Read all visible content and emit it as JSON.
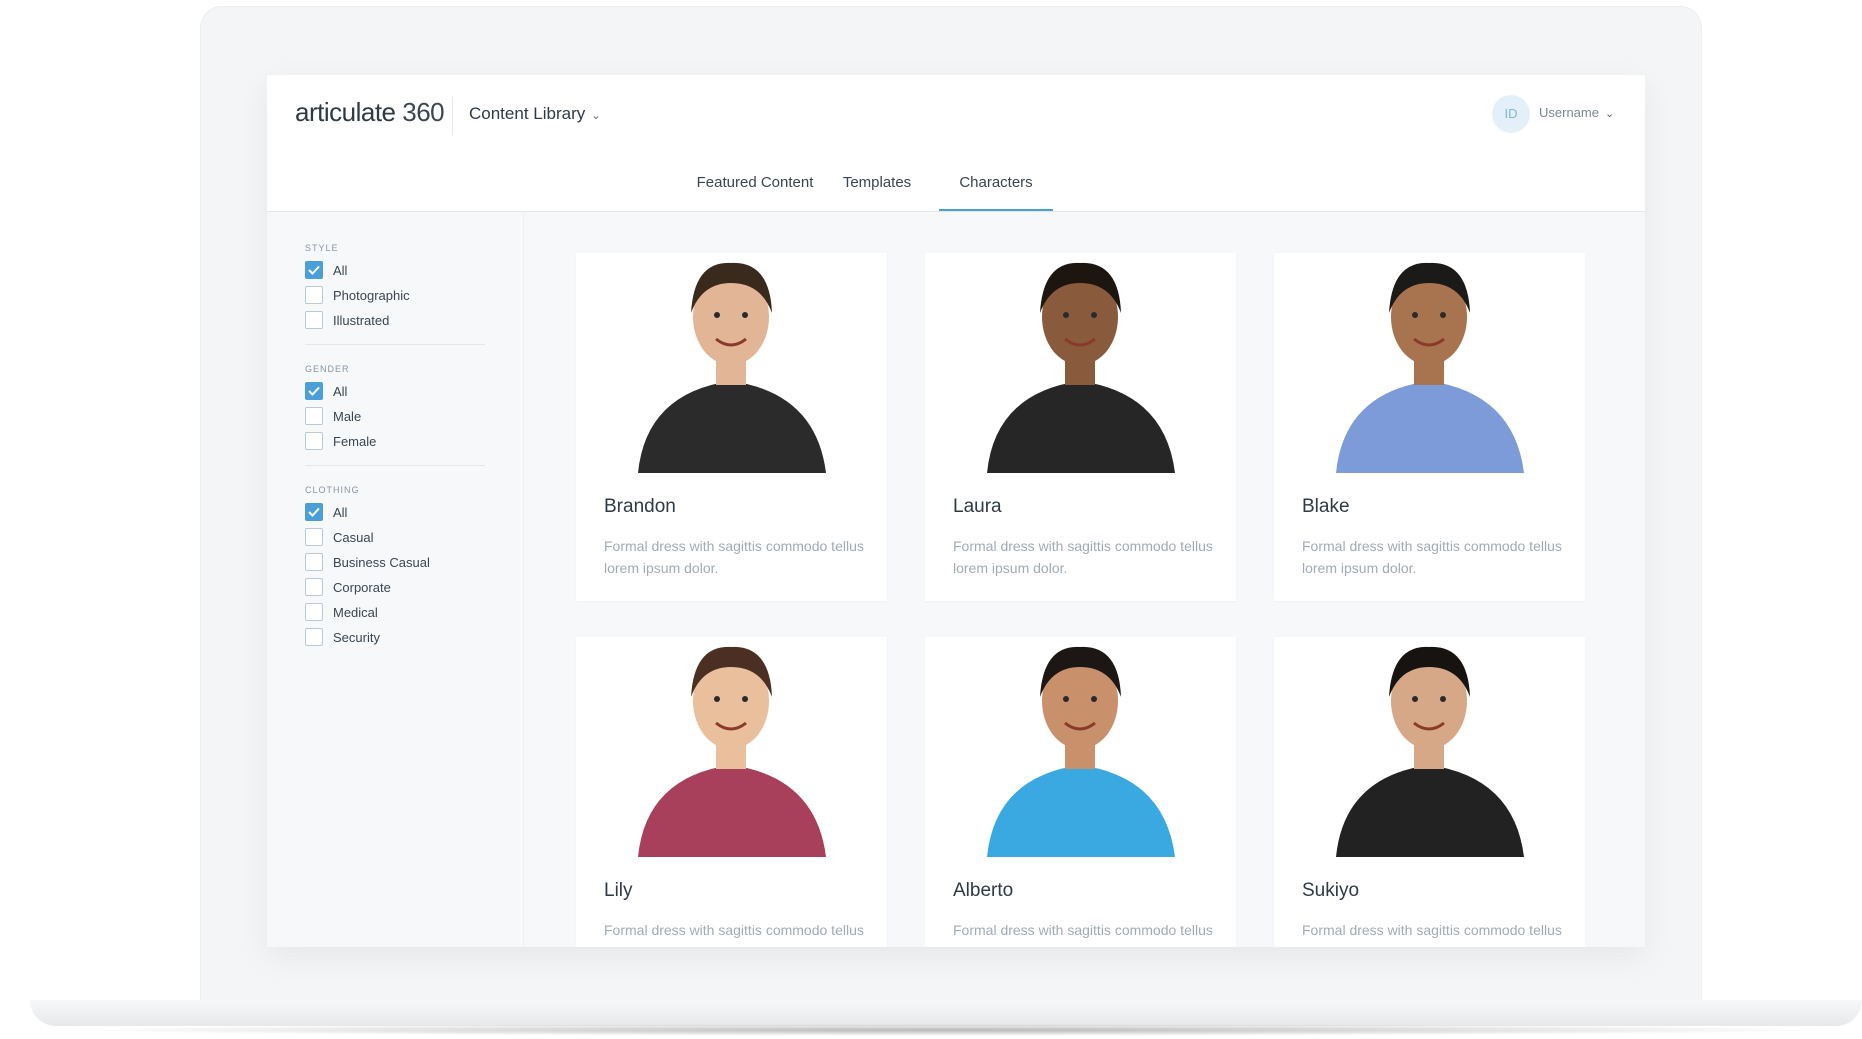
{
  "app": {
    "logo_text": "articulate",
    "logo_number": "360",
    "section": "Content Library",
    "avatar_initials": "ID",
    "username": "Username"
  },
  "tabs": [
    {
      "label": "Featured Content",
      "active": false
    },
    {
      "label": "Templates",
      "active": false
    },
    {
      "label": "Characters",
      "active": true
    }
  ],
  "filters": [
    {
      "title": "STYLE",
      "options": [
        {
          "label": "All",
          "checked": true
        },
        {
          "label": "Photographic",
          "checked": false
        },
        {
          "label": "Illustrated",
          "checked": false
        }
      ]
    },
    {
      "title": "GENDER",
      "options": [
        {
          "label": "All",
          "checked": true
        },
        {
          "label": "Male",
          "checked": false
        },
        {
          "label": "Female",
          "checked": false
        }
      ]
    },
    {
      "title": "CLOTHING",
      "options": [
        {
          "label": "All",
          "checked": true
        },
        {
          "label": "Casual",
          "checked": false
        },
        {
          "label": "Business Casual",
          "checked": false
        },
        {
          "label": "Corporate",
          "checked": false
        },
        {
          "label": "Medical",
          "checked": false
        },
        {
          "label": "Security",
          "checked": false
        }
      ]
    }
  ],
  "characters": [
    {
      "name": "Brandon",
      "description": "Formal dress with sagittis commodo tellus lorem ipsum dolor.",
      "shirt": "#2b2b2b",
      "skin": "#e2b597",
      "hair": "#3a2a1e"
    },
    {
      "name": "Laura",
      "description": "Formal dress with sagittis commodo tellus lorem ipsum dolor.",
      "shirt": "#262626",
      "skin": "#8a5a3c",
      "hair": "#1d1510"
    },
    {
      "name": "Blake",
      "description": "Formal dress with sagittis commodo tellus lorem ipsum dolor.",
      "shirt": "#7d9bd8",
      "skin": "#a8734f",
      "hair": "#1c1a18"
    },
    {
      "name": "Lily",
      "description": "Formal dress with sagittis commodo tellus lorem ipsum dolor.",
      "shirt": "#a8405c",
      "skin": "#e9bf9c",
      "hair": "#4a2f22"
    },
    {
      "name": "Alberto",
      "description": "Formal dress with sagittis commodo tellus lorem ipsum dolor.",
      "shirt": "#3aa9e2",
      "skin": "#c8916b",
      "hair": "#1c1714"
    },
    {
      "name": "Sukiyo",
      "description": "Formal dress with sagittis commodo tellus lorem ipsum dolor.",
      "shirt": "#222222",
      "skin": "#d6a888",
      "hair": "#161311"
    }
  ],
  "colors": {
    "accent": "#4a9fd8"
  }
}
